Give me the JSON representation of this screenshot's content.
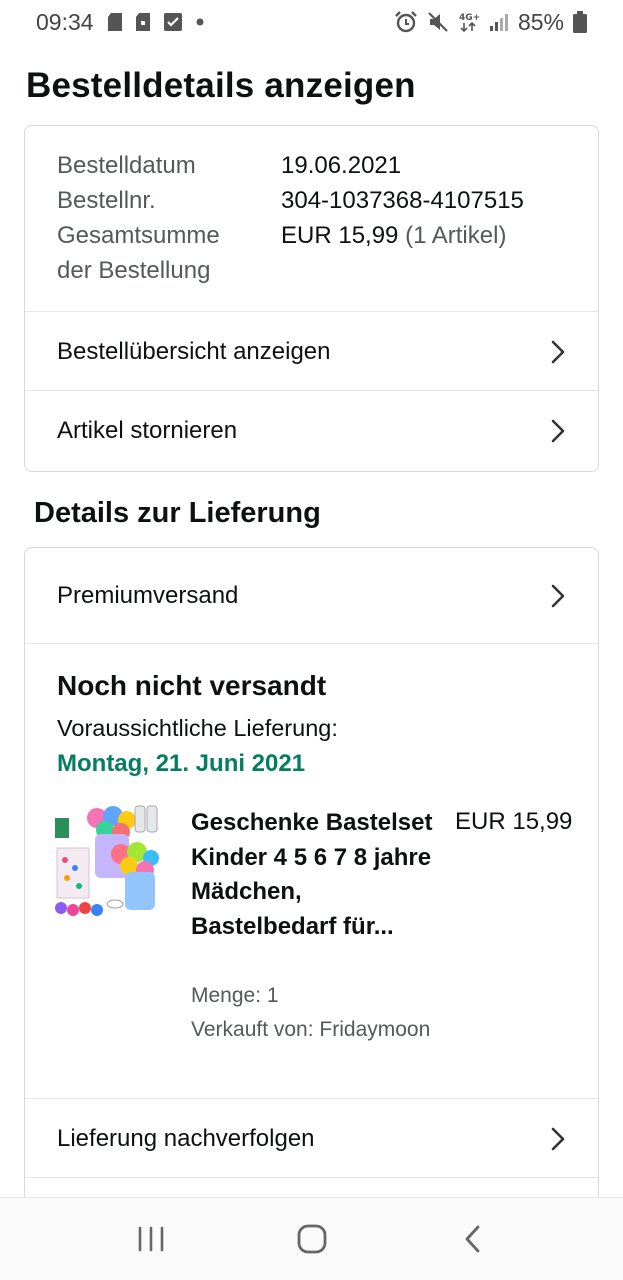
{
  "status_bar": {
    "time": "09:34",
    "battery": "85%",
    "network": "4G+"
  },
  "page": {
    "title": "Bestelldetails anzeigen"
  },
  "summary": {
    "order_date_label": "Bestelldatum",
    "order_date": "19.06.2021",
    "order_number_label": "Bestellnr.",
    "order_number": "304-1037368-4107515",
    "total_label_line1": "Gesamtsumme",
    "total_label_line2": "der Bestellung",
    "total_amount": "EUR 15,99",
    "total_items": "(1 Artikel)",
    "link_overview": "Bestellübersicht anzeigen",
    "link_cancel": "Artikel stornieren"
  },
  "delivery": {
    "section_title": "Details zur Lieferung",
    "shipping_method": "Premiumversand",
    "status": "Noch nicht versandt",
    "eta_label": "Voraussichtliche Lieferung:",
    "eta_date": "Montag, 21. Juni 2021",
    "product": {
      "title": "Geschenke Bastelset Kinder 4 5 6 7 8 jahre Mädchen, Bastelbedarf für...",
      "price": "EUR 15,99",
      "quantity": "Menge: 1",
      "seller": "Verkauft von: Fridaymoon"
    },
    "link_track": "Lieferung nachverfolgen"
  },
  "colors": {
    "accent_green": "#067d62",
    "border": "#d5d9d9",
    "muted_text": "#565959"
  }
}
